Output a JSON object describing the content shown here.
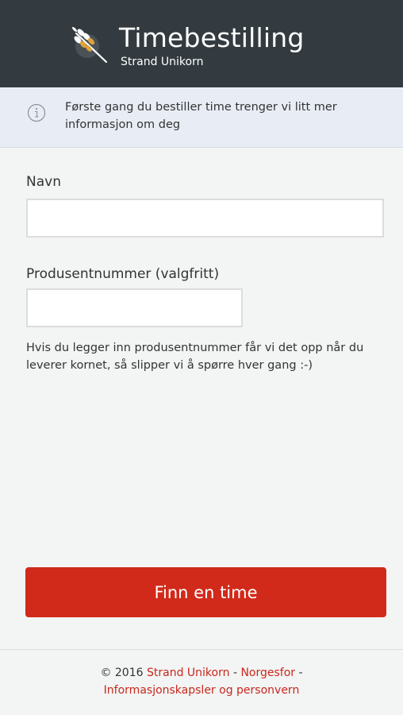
{
  "header": {
    "title": "Timebestilling",
    "subtitle": "Strand Unikorn",
    "logo_icon": "wheat-logo-icon",
    "background": "#333b40"
  },
  "info_bar": {
    "icon": "info-icon",
    "text": "Første gang du bestiller time trenger vi litt mer informasjon om deg"
  },
  "form": {
    "name_label": "Navn",
    "name_value": "",
    "producer_label": "Produsentnummer (valgfritt)",
    "producer_value": "",
    "help_text": "Hvis du legger inn produsentnummer får vi det opp når du leverer kornet, så slipper vi å spørre hver gang :-)"
  },
  "submit_button": {
    "label": "Finn en time",
    "color": "#d12a1a"
  },
  "footer": {
    "copyright": "© 2016",
    "link_company": "Strand Unikorn",
    "separator1": "-",
    "link_norgesfor": "Norgesfor",
    "separator2": "-",
    "link_privacy": "Informasjonskapsler og personvern",
    "link_color": "#c8281c"
  }
}
